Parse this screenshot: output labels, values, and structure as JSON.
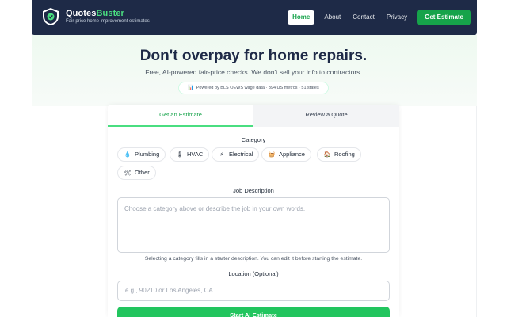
{
  "header": {
    "brand_part1": "Quotes",
    "brand_part2": "Buster",
    "tagline": "Fair-price home improvement estimates",
    "nav": [
      "Home",
      "About",
      "Contact",
      "Privacy"
    ],
    "cta": "Get Estimate",
    "colors": {
      "bar": "#1e2a47",
      "accent": "#16a34a"
    }
  },
  "hero": {
    "title": "Don't overpay for home repairs.",
    "subtitle": "Free, AI-powered fair-price checks. We don't sell your info to contractors.",
    "pill": "Powered by BLS OEWS wage data · 394 US metros · 51 states",
    "pill_icon": "chart-icon"
  },
  "tabs": [
    "Get an Estimate",
    "Review a Quote"
  ],
  "form": {
    "category_label": "Category",
    "categories": [
      {
        "icon": "💧",
        "label": "Plumbing"
      },
      {
        "icon": "🌡",
        "label": "HVAC"
      },
      {
        "icon": "⚡",
        "label": "Electrical"
      },
      {
        "icon": "🧺",
        "label": "Appliance"
      },
      {
        "icon": "🏠",
        "label": "Roofing"
      },
      {
        "icon": "🛠",
        "label": "Other"
      }
    ],
    "job_label": "Job Description",
    "job_placeholder": "Choose a category above or describe the job in your own words.",
    "hint": "Selecting a category fills in a starter description. You can edit it before starting the estimate.",
    "location_label": "Location (Optional)",
    "location_placeholder": "e.g., 90210 or Los Angeles, CA",
    "submit": "Start AI Estimate"
  }
}
